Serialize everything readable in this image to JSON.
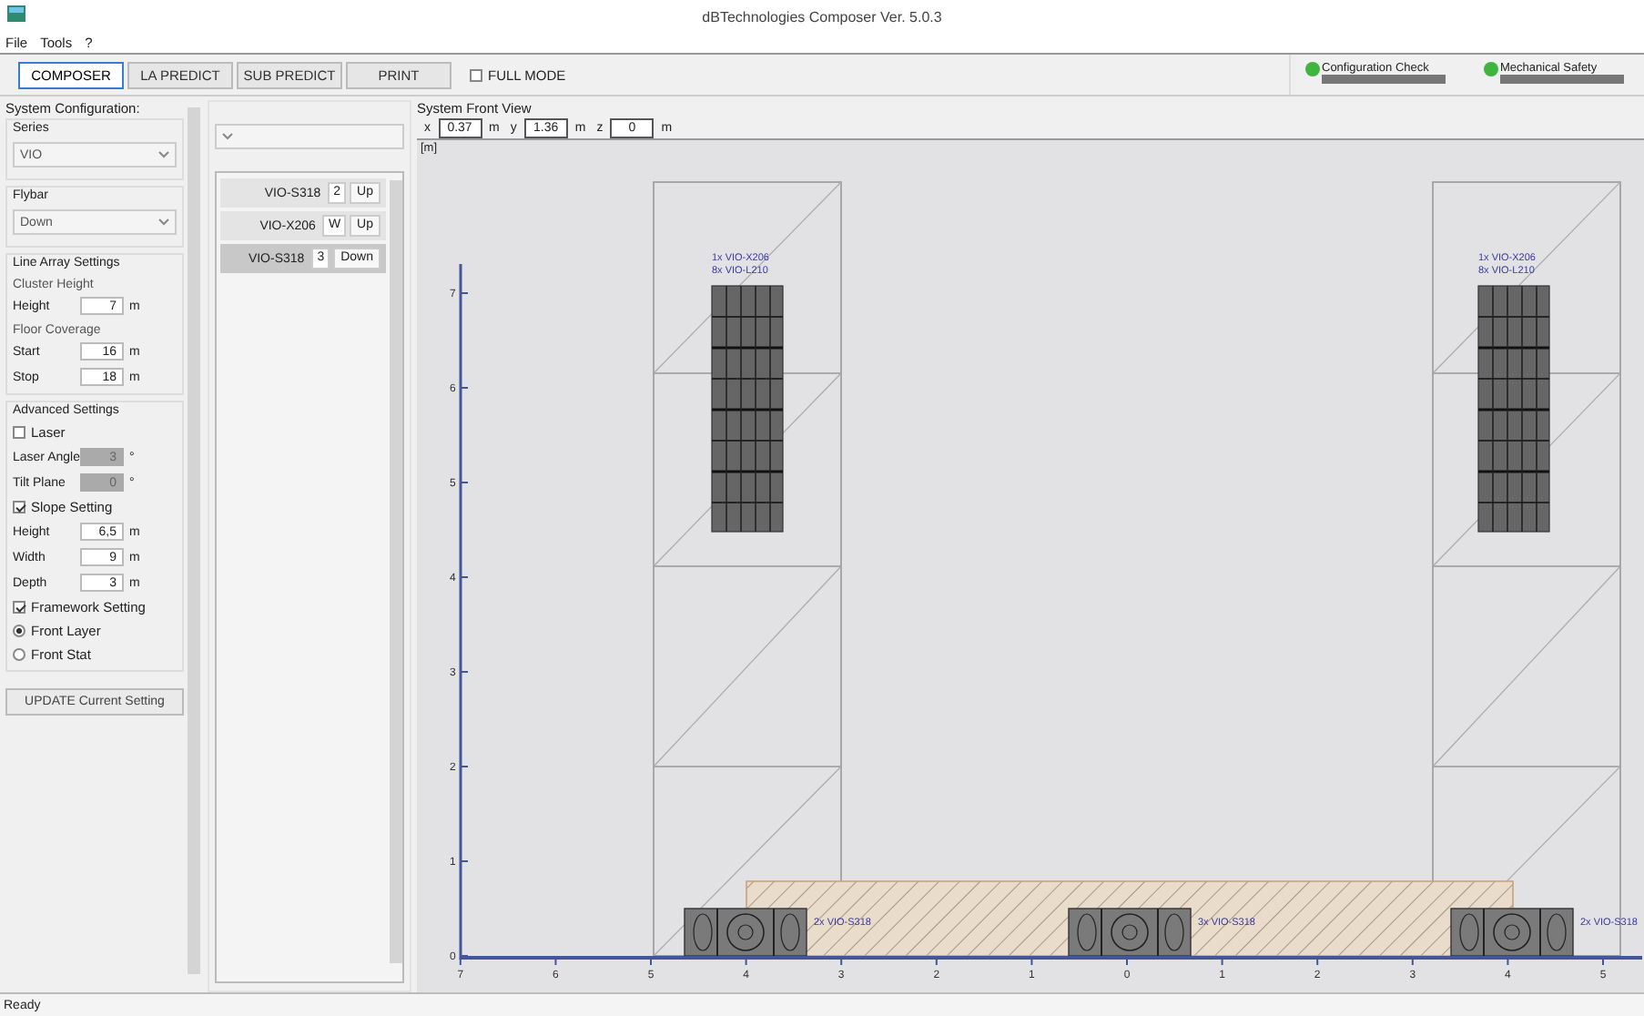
{
  "window": {
    "title": "dBTechnologies Composer Ver. 5.0.3"
  },
  "menu": [
    "File",
    "Tools",
    "?"
  ],
  "toolbar": {
    "buttons": [
      {
        "label": "COMPOSER",
        "selected": true
      },
      {
        "label": "LA PREDICT",
        "selected": false
      },
      {
        "label": "SUB PREDICT",
        "selected": false
      },
      {
        "label": "PRINT",
        "selected": false
      }
    ],
    "full_mode": {
      "label": "FULL MODE",
      "checked": false
    },
    "indicators": [
      {
        "label": "Configuration Check",
        "color": "#3fb53f"
      },
      {
        "label": "Mechanical Safety",
        "color": "#3fb53f"
      }
    ]
  },
  "system_configuration": {
    "title": "System Configuration:",
    "sections": [
      {
        "title": "Series",
        "items": [
          {
            "kind": "select",
            "value": "VIO"
          }
        ]
      },
      {
        "title": "Flybar",
        "items": [
          {
            "kind": "select",
            "value": "Down"
          }
        ]
      },
      {
        "title": "Line Array Settings",
        "items": [
          {
            "kind": "subtitle",
            "label": "Cluster Height"
          },
          {
            "kind": "number",
            "label": "Height",
            "value": "7",
            "unit": "m",
            "disabled": false
          },
          {
            "kind": "subtitle",
            "label": "Floor Coverage"
          },
          {
            "kind": "number",
            "label": "Start",
            "value": "16",
            "unit": "m",
            "disabled": false
          },
          {
            "kind": "number",
            "label": "Stop",
            "value": "18",
            "unit": "m",
            "disabled": false
          }
        ]
      },
      {
        "title": "Advanced Settings",
        "items": [
          {
            "kind": "checkbox",
            "label": "Laser",
            "checked": false
          },
          {
            "kind": "number",
            "label": "Laser Angle",
            "value": "3",
            "unit": "°",
            "disabled": true
          },
          {
            "kind": "number",
            "label": "Tilt Plane",
            "value": "0",
            "unit": "°",
            "disabled": true
          },
          {
            "kind": "checkbox",
            "label": "Slope Setting",
            "checked": true
          },
          {
            "kind": "number",
            "label": "Height",
            "value": "6,5",
            "unit": "m",
            "disabled": false
          },
          {
            "kind": "number",
            "label": "Width",
            "value": "9",
            "unit": "m",
            "disabled": false
          },
          {
            "kind": "number",
            "label": "Depth",
            "value": "3",
            "unit": "m",
            "disabled": false
          },
          {
            "kind": "checkbox",
            "label": "Framework Setting",
            "checked": true
          },
          {
            "kind": "radio",
            "label": "Front Layer",
            "selected": true
          },
          {
            "kind": "radio",
            "label": "Front Stat",
            "selected": false
          }
        ]
      }
    ],
    "update_button": "UPDATE Current Setting"
  },
  "module_list": {
    "rows": [
      {
        "model": "VIO-S318",
        "count": "2",
        "position": "Up",
        "selected": false
      },
      {
        "model": "VIO-X206",
        "count": "W",
        "position": "Up",
        "selected": false
      },
      {
        "model": "VIO-S318",
        "count": "3",
        "position": "Down",
        "selected": true
      }
    ]
  },
  "front_view": {
    "title": "System Front View",
    "coordinates": [
      {
        "axis": "x",
        "value": "0.37",
        "unit": "m"
      },
      {
        "axis": "y",
        "value": "1.36",
        "unit": "m"
      },
      {
        "axis": "z",
        "value": "0",
        "unit": "m"
      }
    ],
    "unit_label": "[m]",
    "y_ticks": [
      "7",
      "6",
      "5",
      "4",
      "3",
      "2",
      "1",
      "0"
    ],
    "x_ticks": [
      "7",
      "6",
      "5",
      "4",
      "3",
      "2",
      "1",
      "0",
      "1",
      "2",
      "3",
      "4",
      "5"
    ],
    "arrays": [
      {
        "labels": [
          "1x VIO-X206",
          "8x VIO-L210"
        ]
      },
      {
        "labels": [
          "1x VIO-X206",
          "8x VIO-L210"
        ]
      }
    ],
    "subwoofers": [
      {
        "label": "2x VIO-S318"
      },
      {
        "label": "3x VIO-S318"
      },
      {
        "label": "2x VIO-S318"
      }
    ]
  },
  "status_bar": "Ready"
}
